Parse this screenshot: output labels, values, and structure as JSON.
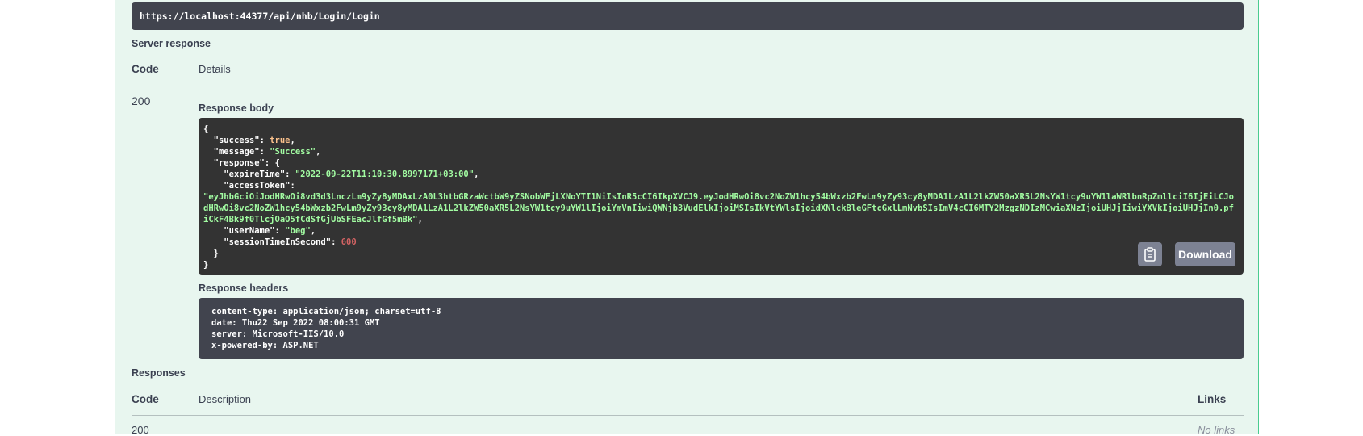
{
  "request_url": "https://localhost:44377/api/nhb/Login/Login",
  "server_response": {
    "title": "Server response",
    "columns": {
      "code": "Code",
      "details": "Details"
    },
    "status_code": "200",
    "body_label": "Response body",
    "body": {
      "open_brace": "{",
      "success_key": "\"success\"",
      "success_val": "true",
      "message_key": "\"message\"",
      "message_val": "\"Success\"",
      "response_key": "\"response\"",
      "open_inner": "{",
      "expire_key": "\"expireTime\"",
      "expire_val": "\"2022-09-22T11:10:30.8997171+03:00\"",
      "token_key": "\"accessToken\"",
      "token_val": "\"eyJhbGciOiJodHRwOi8vd3d3LnczLm9yZy8yMDAxLzA0L3htbGRzaWctbW9yZSNobWFjLXNoYTI1NiIsInR5cCI6IkpXVCJ9.eyJodHRwOi8vc2NoZW1hcy54bWxzb2FwLm9yZy93cy8yMDA1LzA1L2lkZW50aXR5L2NsYW1tcy9uYW1laWRlbnRpZmllciI6IjEiLCJodHRwOi8vc2NoZW1hcy54bWxzb2FwLm9yZy93cy8yMDA1LzA1L2lkZW50aXR5L2NsYW1tcy9uYW1lIjoiYmVnIiwiQWNjb3VudElkIjoiMSIsIkVtYWlsIjoidXNlckBleGFtcGxlLmNvbSIsImV4cCI6MTY2MzgzNDIzMCwiaXNzIjoiUHJjIiwiYXVkIjoiUHJjIn0.pfiCkF4Bk9f0TlcjOaO5fCdSfGjUbSFEacJlfGf5mBk\"",
      "username_key": "\"userName\"",
      "username_val": "\"beg\"",
      "session_key": "\"sessionTimeInSecond\"",
      "session_val": "600",
      "close_inner": "}",
      "close_brace": "}"
    },
    "download_label": "Download",
    "headers_label": "Response headers",
    "headers": [
      "content-type: application/json; charset=utf-8",
      "date: Thu22 Sep 2022 08:00:31 GMT",
      "server: Microsoft-IIS/10.0",
      "x-powered-by: ASP.NET"
    ]
  },
  "responses": {
    "title": "Responses",
    "columns": {
      "code": "Code",
      "description": "Description",
      "links": "Links"
    },
    "first_row_code": "200",
    "first_row_links": "No links"
  }
}
